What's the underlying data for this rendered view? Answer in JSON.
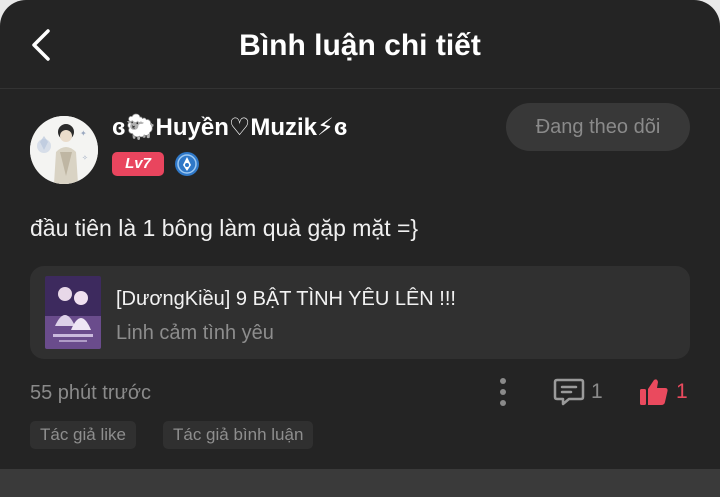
{
  "header": {
    "title": "Bình luận chi tiết",
    "back_icon": "chevron-left-icon"
  },
  "user": {
    "name": "ɞ🐑Huyền♡Muzik⚡ɞ",
    "level": "Lv7",
    "medal_icon": "medal-icon"
  },
  "follow_button": {
    "label": "Đang theo dõi"
  },
  "comment": {
    "text": "đầu tiên là 1 bông làm quà gặp mặt =}",
    "time": "55 phút trước"
  },
  "song_card": {
    "title": "[DươngKiều] 9 BẬT TÌNH YÊU LÊN !!!",
    "subtitle": "Linh cảm tình yêu"
  },
  "actions": {
    "more_icon": "more-vertical-icon",
    "reply_icon": "comment-icon",
    "reply_count": "1",
    "like_icon": "thumbs-up-icon",
    "like_count": "1"
  },
  "tags": [
    {
      "label": "Tác giả like"
    },
    {
      "label": "Tác giả bình luận"
    }
  ],
  "colors": {
    "background": "#242424",
    "card": "#303030",
    "accent": "#ea4a5e",
    "badge": "#e9455e",
    "medal": "#3a8de0",
    "text_primary": "#ffffff",
    "text_secondary": "#8a8a8a"
  }
}
